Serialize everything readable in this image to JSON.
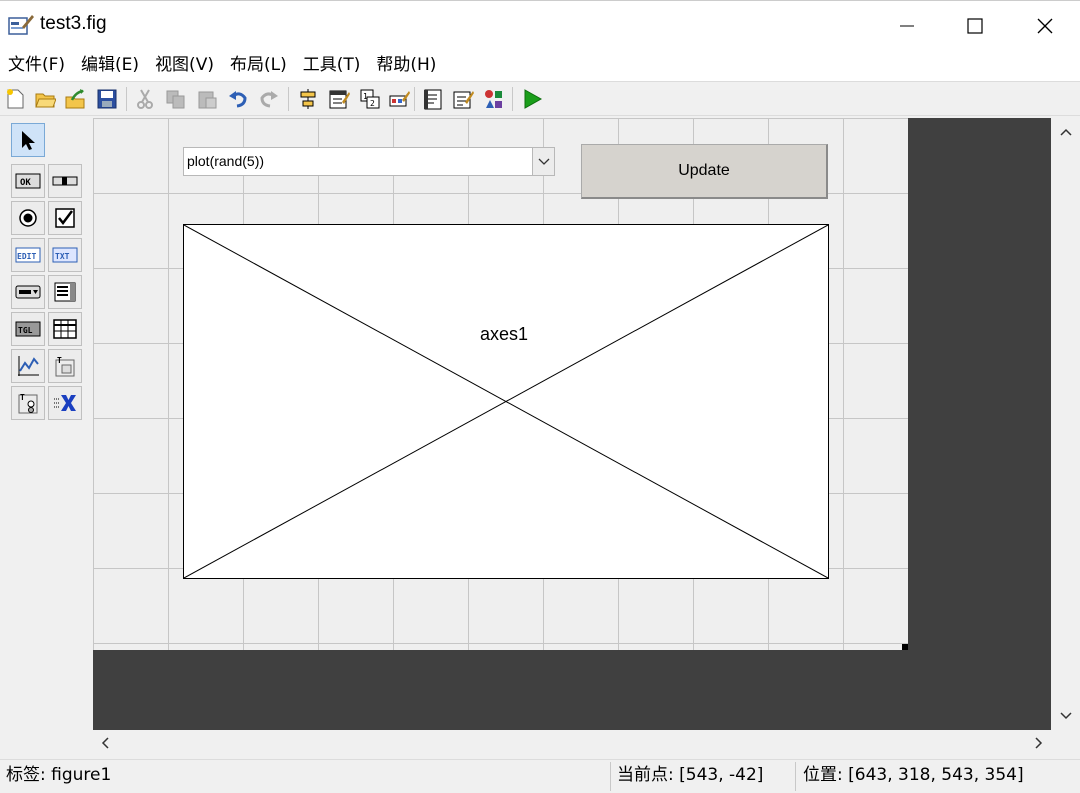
{
  "window": {
    "title": "test3.fig"
  },
  "menu": [
    {
      "label": "文件(F)"
    },
    {
      "label": "编辑(E)"
    },
    {
      "label": "视图(V)"
    },
    {
      "label": "布局(L)"
    },
    {
      "label": "工具(T)"
    },
    {
      "label": "帮助(H)"
    }
  ],
  "toolbar": {
    "icons": [
      "new-file-icon",
      "open-folder-icon",
      "export-icon",
      "save-icon",
      "cut-icon",
      "copy-icon",
      "paste-icon",
      "undo-icon",
      "redo-icon",
      "align-icon",
      "menu-editor-icon",
      "tab-order-icon",
      "toolbar-editor-icon",
      "editor-icon",
      "property-inspector-icon",
      "object-browser-icon",
      "run-icon"
    ]
  },
  "palette": {
    "tools": [
      "select-arrow",
      "pushbutton",
      "slider",
      "radiobutton",
      "checkbox",
      "edit-text",
      "static-text",
      "popup-menu",
      "listbox",
      "toggle-button",
      "table",
      "axes",
      "panel",
      "button-group",
      "activex"
    ]
  },
  "design": {
    "popup_value": "plot(rand(5))",
    "update_label": "Update",
    "axes_label": "axes1"
  },
  "status": {
    "tag": "标签: figure1",
    "current_point": "当前点:  [543, -42]",
    "position": "位置: [643, 318, 543, 354]"
  },
  "colors": {
    "canvas_bg": "#404040",
    "grid_bg": "#efefef",
    "button_bg": "#d6d3ce",
    "run_green": "#1a9e1a"
  }
}
